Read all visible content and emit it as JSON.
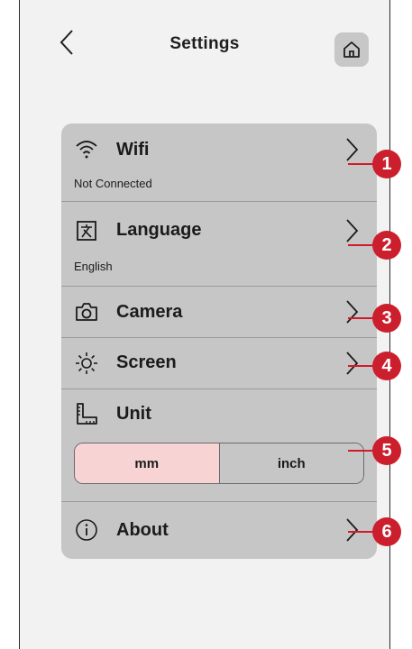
{
  "header": {
    "title": "Settings"
  },
  "menu": {
    "wifi": {
      "label": "Wifi",
      "status": "Not Connected"
    },
    "language": {
      "label": "Language",
      "value": "English"
    },
    "camera": {
      "label": "Camera"
    },
    "screen": {
      "label": "Screen"
    },
    "unit": {
      "label": "Unit",
      "options": [
        "mm",
        "inch"
      ],
      "selected": "mm"
    },
    "about": {
      "label": "About"
    }
  },
  "callouts": [
    "1",
    "2",
    "3",
    "4",
    "5",
    "6"
  ],
  "colors": {
    "panel": "#c6c6c6",
    "selected": "#f8d3d4",
    "callout": "#cc1f2e"
  },
  "icons": {
    "back": "chevron-left-icon",
    "home": "home-icon",
    "wifi": "wifi-icon",
    "language": "language-icon",
    "camera": "camera-icon",
    "screen": "brightness-icon",
    "unit": "ruler-icon",
    "about": "info-icon",
    "chevron": "chevron-right-icon"
  }
}
